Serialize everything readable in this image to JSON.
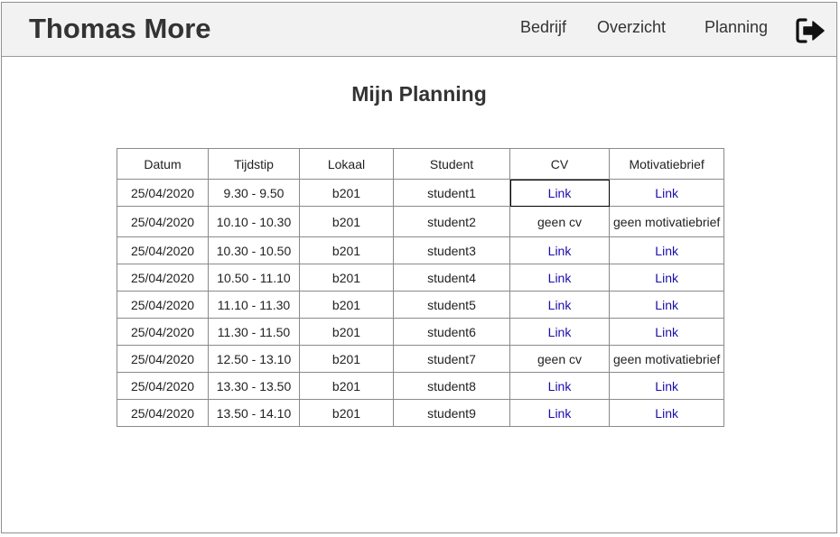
{
  "header": {
    "brand": "Thomas More",
    "nav": [
      {
        "label": "Bedrijf"
      },
      {
        "label": "Overzicht"
      },
      {
        "label": "Planning"
      }
    ],
    "logout_icon": "sign-out-icon"
  },
  "page": {
    "title": "Mijn Planning"
  },
  "table": {
    "headers": [
      "Datum",
      "Tijdstip",
      "Lokaal",
      "Student",
      "CV",
      "Motivatiebrief"
    ],
    "rows": [
      {
        "datum": "25/04/2020",
        "tijd": "9.30 - 9.50",
        "lokaal": "b201",
        "student": "student1",
        "cv": "Link",
        "motiv": "Link"
      },
      {
        "datum": "25/04/2020",
        "tijd": "10.10 - 10.30",
        "lokaal": "b201",
        "student": "student2",
        "cv": "geen cv",
        "motiv": "geen motivatiebrief"
      },
      {
        "datum": "25/04/2020",
        "tijd": "10.30 - 10.50",
        "lokaal": "b201",
        "student": "student3",
        "cv": "Link",
        "motiv": "Link"
      },
      {
        "datum": "25/04/2020",
        "tijd": "10.50 - 11.10",
        "lokaal": "b201",
        "student": "student4",
        "cv": "Link",
        "motiv": "Link"
      },
      {
        "datum": "25/04/2020",
        "tijd": "11.10 - 11.30",
        "lokaal": "b201",
        "student": "student5",
        "cv": "Link",
        "motiv": "Link"
      },
      {
        "datum": "25/04/2020",
        "tijd": "11.30 - 11.50",
        "lokaal": "b201",
        "student": "student6",
        "cv": "Link",
        "motiv": "Link"
      },
      {
        "datum": "25/04/2020",
        "tijd": "12.50 - 13.10",
        "lokaal": "b201",
        "student": "student7",
        "cv": "geen cv",
        "motiv": "geen motivatiebrief"
      },
      {
        "datum": "25/04/2020",
        "tijd": "13.30 - 13.50",
        "lokaal": "b201",
        "student": "student8",
        "cv": "Link",
        "motiv": "Link"
      },
      {
        "datum": "25/04/2020",
        "tijd": "13.50 - 14.10",
        "lokaal": "b201",
        "student": "student9",
        "cv": "Link",
        "motiv": "Link"
      }
    ]
  },
  "colors": {
    "header_bg": "#f2f2f2",
    "link": "#1a0dab",
    "text": "#333333"
  }
}
